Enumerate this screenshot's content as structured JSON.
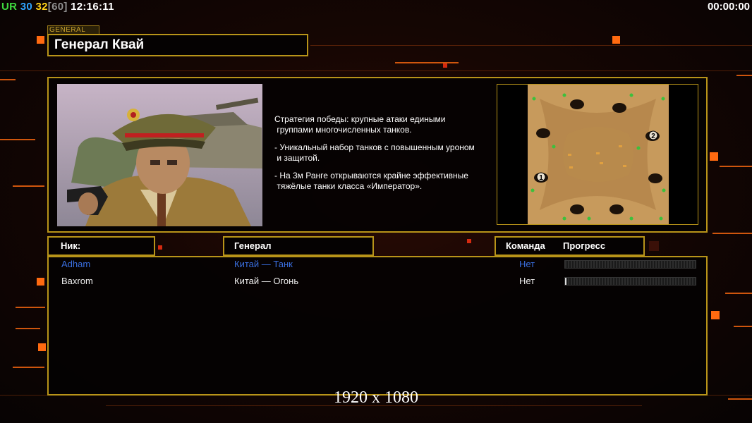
{
  "hud": {
    "ur_label": "UR",
    "val1": "30",
    "val2": "32",
    "val3": "[60]",
    "clock": "12:16:11",
    "timer": "00:00:00",
    "colors": {
      "ur": "#3fd93f",
      "val1": "#2fa4ff",
      "val2": "#ffd21a",
      "val3": "#8f8f8f"
    }
  },
  "general": {
    "tag": "GENERAL",
    "name": "Генерал Квай"
  },
  "description": {
    "p1": "Стратегия победы: крупные атаки едиными\n группами многочисленных танков.",
    "p2": "- Уникальный набор танков с повышенным уроном\n и защитой.",
    "p3": "- На 3м Ранге открываются крайне эффективные\n тяжёлые танки класса «Император»."
  },
  "map": {
    "start_1": "1",
    "start_2": "2"
  },
  "headers": {
    "nick": "Ник:",
    "general": "Генерал",
    "team": "Команда",
    "progress": "Прогресс"
  },
  "players": [
    {
      "nick": "Adham",
      "general": "Китай — Танк",
      "team": "Нет",
      "progress": 0.0,
      "color": "#3a6fe0"
    },
    {
      "nick": "Baxrom",
      "general": "Китай — Огонь",
      "team": "Нет",
      "progress": 0.01,
      "color": "#f0f0f0"
    }
  ],
  "resolution": "1920 x 1080",
  "colors": {
    "accent": "#ff6a10",
    "frame": "#b89419"
  }
}
